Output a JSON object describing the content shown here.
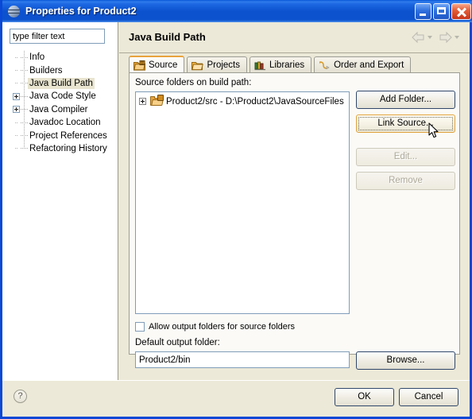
{
  "window": {
    "title": "Properties for Product2",
    "icon": "eclipse-icon",
    "controls": {
      "minimize": "minimize-icon",
      "maximize": "maximize-icon",
      "close": "close-icon"
    }
  },
  "sidebar": {
    "filter": {
      "value": "type filter text",
      "placeholder": "type filter text"
    },
    "items": [
      {
        "label": "Info",
        "expandable": false,
        "selected": false
      },
      {
        "label": "Builders",
        "expandable": false,
        "selected": false
      },
      {
        "label": "Java Build Path",
        "expandable": false,
        "selected": true
      },
      {
        "label": "Java Code Style",
        "expandable": true,
        "selected": false
      },
      {
        "label": "Java Compiler",
        "expandable": true,
        "selected": false
      },
      {
        "label": "Javadoc Location",
        "expandable": false,
        "selected": false
      },
      {
        "label": "Project References",
        "expandable": false,
        "selected": false
      },
      {
        "label": "Refactoring History",
        "expandable": false,
        "selected": false
      }
    ]
  },
  "page": {
    "title": "Java Build Path",
    "nav": {
      "back": "back-arrow-icon",
      "forward": "forward-arrow-icon"
    },
    "tabs": [
      {
        "label": "Source",
        "icon": "source-folder-icon",
        "active": true
      },
      {
        "label": "Projects",
        "icon": "projects-folder-icon",
        "active": false
      },
      {
        "label": "Libraries",
        "icon": "libraries-books-icon",
        "active": false
      },
      {
        "label": "Order and Export",
        "icon": "order-export-icon",
        "active": false
      }
    ]
  },
  "source_tab": {
    "list_label": "Source folders on build path:",
    "entries": [
      {
        "label": "Product2/src - D:\\Product2\\JavaSourceFiles",
        "icon": "source-folder-icon",
        "expandable": true
      }
    ],
    "buttons": [
      {
        "label": "Add Folder...",
        "state": "normal"
      },
      {
        "label": "Link Source...",
        "state": "hover"
      },
      {
        "label": "Edit...",
        "state": "disabled"
      },
      {
        "label": "Remove",
        "state": "disabled"
      }
    ],
    "allow_output_checkbox": {
      "label": "Allow output folders for source folders",
      "checked": false
    },
    "default_output_label": "Default output folder:",
    "default_output_value": "Product2/bin",
    "browse_label": "Browse..."
  },
  "footer": {
    "help": "?",
    "ok": "OK",
    "cancel": "Cancel"
  },
  "colors": {
    "titlebar_blue": "#0c52cf",
    "dialog_bg": "#ece9d8",
    "selection": "#e8e4cf",
    "accent_orange": "#e8a33d",
    "border_blue": "#0a48d6"
  }
}
